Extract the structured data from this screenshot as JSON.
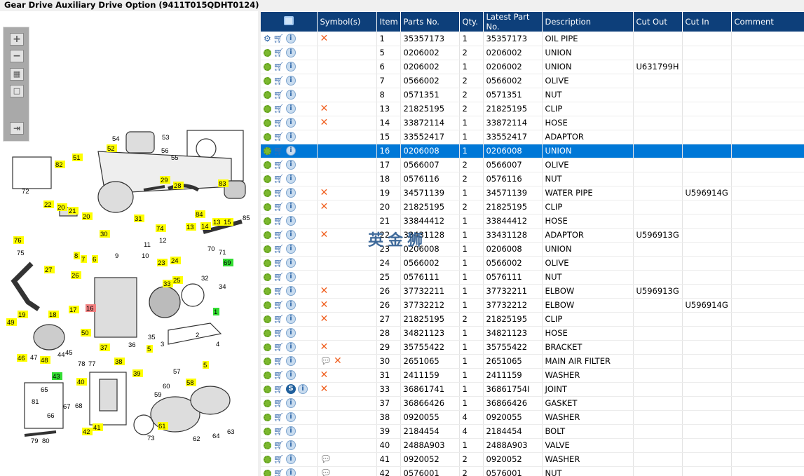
{
  "title": "Gear Drive Auxiliary Drive Option (9411T015QDHT0124)",
  "toolbar": {
    "zoom_in": "+",
    "zoom_out": "−",
    "fit": "▦",
    "actual": "□",
    "export": "⇥"
  },
  "watermark": "英金狮",
  "colors": {
    "header": "#0d3f7a",
    "selected": "#0078d7",
    "callout_yellow": "#ffff00",
    "callout_green": "#33dd33",
    "callout_red": "#f08080"
  },
  "grid": {
    "columns": [
      "",
      "Symbol(s)",
      "Item",
      "Parts No.",
      "Qty.",
      "Latest Part No.",
      "Description",
      "Cut Out",
      "Cut In",
      "Comment"
    ],
    "rows": [
      {
        "icons": "multi",
        "sym": [
          "x"
        ],
        "item": "1",
        "part": "35357173",
        "qty": "1",
        "latest": "35357173",
        "desc": "OIL PIPE",
        "out": "",
        "in": ""
      },
      {
        "sym": [],
        "item": "5",
        "part": "0206002",
        "qty": "2",
        "latest": "0206002",
        "desc": "UNION",
        "out": "",
        "in": ""
      },
      {
        "sym": [],
        "item": "6",
        "part": "0206002",
        "qty": "1",
        "latest": "0206002",
        "desc": "UNION",
        "out": "U631799H",
        "in": ""
      },
      {
        "sym": [],
        "item": "7",
        "part": "0566002",
        "qty": "2",
        "latest": "0566002",
        "desc": "OLIVE",
        "out": "",
        "in": ""
      },
      {
        "sym": [],
        "item": "8",
        "part": "0571351",
        "qty": "2",
        "latest": "0571351",
        "desc": "NUT",
        "out": "",
        "in": ""
      },
      {
        "sym": [
          "x"
        ],
        "item": "13",
        "part": "21825195",
        "qty": "2",
        "latest": "21825195",
        "desc": "CLIP",
        "out": "",
        "in": ""
      },
      {
        "sym": [
          "x"
        ],
        "item": "14",
        "part": "33872114",
        "qty": "1",
        "latest": "33872114",
        "desc": "HOSE",
        "out": "",
        "in": ""
      },
      {
        "sym": [],
        "item": "15",
        "part": "33552417",
        "qty": "1",
        "latest": "33552417",
        "desc": "ADAPTOR",
        "out": "",
        "in": ""
      },
      {
        "sym": [],
        "item": "16",
        "part": "0206008",
        "qty": "1",
        "latest": "0206008",
        "desc": "UNION",
        "out": "",
        "in": "",
        "selected": true
      },
      {
        "sym": [],
        "item": "17",
        "part": "0566007",
        "qty": "2",
        "latest": "0566007",
        "desc": "OLIVE",
        "out": "",
        "in": ""
      },
      {
        "sym": [],
        "item": "18",
        "part": "0576116",
        "qty": "2",
        "latest": "0576116",
        "desc": "NUT",
        "out": "",
        "in": ""
      },
      {
        "sym": [
          "x"
        ],
        "item": "19",
        "part": "34571139",
        "qty": "1",
        "latest": "34571139",
        "desc": "WATER PIPE",
        "out": "",
        "in": "U596914G"
      },
      {
        "sym": [
          "x"
        ],
        "item": "20",
        "part": "21825195",
        "qty": "2",
        "latest": "21825195",
        "desc": "CLIP",
        "out": "",
        "in": ""
      },
      {
        "sym": [],
        "item": "21",
        "part": "33844412",
        "qty": "1",
        "latest": "33844412",
        "desc": "HOSE",
        "out": "",
        "in": ""
      },
      {
        "sym": [
          "x"
        ],
        "item": "22",
        "part": "33431128",
        "qty": "1",
        "latest": "33431128",
        "desc": "ADAPTOR",
        "out": "U596913G",
        "in": ""
      },
      {
        "sym": [],
        "item": "23",
        "part": "0206008",
        "qty": "1",
        "latest": "0206008",
        "desc": "UNION",
        "out": "",
        "in": ""
      },
      {
        "sym": [],
        "item": "24",
        "part": "0566002",
        "qty": "1",
        "latest": "0566002",
        "desc": "OLIVE",
        "out": "",
        "in": ""
      },
      {
        "sym": [],
        "item": "25",
        "part": "0576111",
        "qty": "1",
        "latest": "0576111",
        "desc": "NUT",
        "out": "",
        "in": ""
      },
      {
        "sym": [
          "x"
        ],
        "item": "26",
        "part": "37732211",
        "qty": "1",
        "latest": "37732211",
        "desc": "ELBOW",
        "out": "U596913G",
        "in": ""
      },
      {
        "sym": [
          "x"
        ],
        "item": "26",
        "part": "37732212",
        "qty": "1",
        "latest": "37732212",
        "desc": "ELBOW",
        "out": "",
        "in": "U596914G"
      },
      {
        "sym": [
          "x"
        ],
        "item": "27",
        "part": "21825195",
        "qty": "2",
        "latest": "21825195",
        "desc": "CLIP",
        "out": "",
        "in": ""
      },
      {
        "sym": [],
        "item": "28",
        "part": "34821123",
        "qty": "1",
        "latest": "34821123",
        "desc": "HOSE",
        "out": "",
        "in": ""
      },
      {
        "sym": [
          "x"
        ],
        "item": "29",
        "part": "35755422",
        "qty": "1",
        "latest": "35755422",
        "desc": "BRACKET",
        "out": "",
        "in": ""
      },
      {
        "sym": [
          "note",
          "x"
        ],
        "item": "30",
        "part": "2651065",
        "qty": "1",
        "latest": "2651065",
        "desc": "MAIN AIR FILTER",
        "out": "",
        "in": ""
      },
      {
        "sym": [
          "x"
        ],
        "item": "31",
        "part": "2411159",
        "qty": "1",
        "latest": "2411159",
        "desc": "WASHER",
        "out": "",
        "in": ""
      },
      {
        "icons": "s",
        "sym": [
          "x"
        ],
        "item": "33",
        "part": "36861741",
        "qty": "1",
        "latest": "36861754I",
        "desc": "JOINT",
        "out": "",
        "in": ""
      },
      {
        "sym": [],
        "item": "37",
        "part": "36866426",
        "qty": "1",
        "latest": "36866426",
        "desc": "GASKET",
        "out": "",
        "in": ""
      },
      {
        "sym": [],
        "item": "38",
        "part": "0920055",
        "qty": "4",
        "latest": "0920055",
        "desc": "WASHER",
        "out": "",
        "in": ""
      },
      {
        "sym": [],
        "item": "39",
        "part": "2184454",
        "qty": "4",
        "latest": "2184454",
        "desc": "BOLT",
        "out": "",
        "in": ""
      },
      {
        "sym": [],
        "item": "40",
        "part": "2488A903",
        "qty": "1",
        "latest": "2488A903",
        "desc": "VALVE",
        "out": "",
        "in": ""
      },
      {
        "sym": [
          "note"
        ],
        "item": "41",
        "part": "0920052",
        "qty": "2",
        "latest": "0920052",
        "desc": "WASHER",
        "out": "",
        "in": ""
      },
      {
        "sym": [
          "note"
        ],
        "item": "42",
        "part": "0576001",
        "qty": "2",
        "latest": "0576001",
        "desc": "NUT",
        "out": "",
        "in": ""
      }
    ]
  },
  "diagram": {
    "callouts": [
      "54",
      "53",
      "51",
      "52",
      "56",
      "55",
      "82",
      "83",
      "72",
      "29",
      "28",
      "22",
      "20",
      "21",
      "20",
      "31",
      "84",
      "85",
      "76",
      "30",
      "74",
      "13",
      "14",
      "13",
      "15",
      "12",
      "75",
      "8",
      "7",
      "6",
      "9",
      "10",
      "11",
      "70",
      "71",
      "23",
      "24",
      "69",
      "27",
      "26",
      "25",
      "32",
      "33",
      "34",
      "19",
      "18",
      "17",
      "16",
      "49",
      "1",
      "50",
      "45",
      "47",
      "44",
      "35",
      "36",
      "2",
      "3",
      "4",
      "46",
      "48",
      "37",
      "78",
      "77",
      "38",
      "5",
      "5",
      "39",
      "43",
      "40",
      "57",
      "58",
      "65",
      "81",
      "66",
      "67",
      "68",
      "60",
      "59",
      "61",
      "62",
      "73",
      "42",
      "41",
      "64",
      "63",
      "79",
      "80"
    ]
  }
}
